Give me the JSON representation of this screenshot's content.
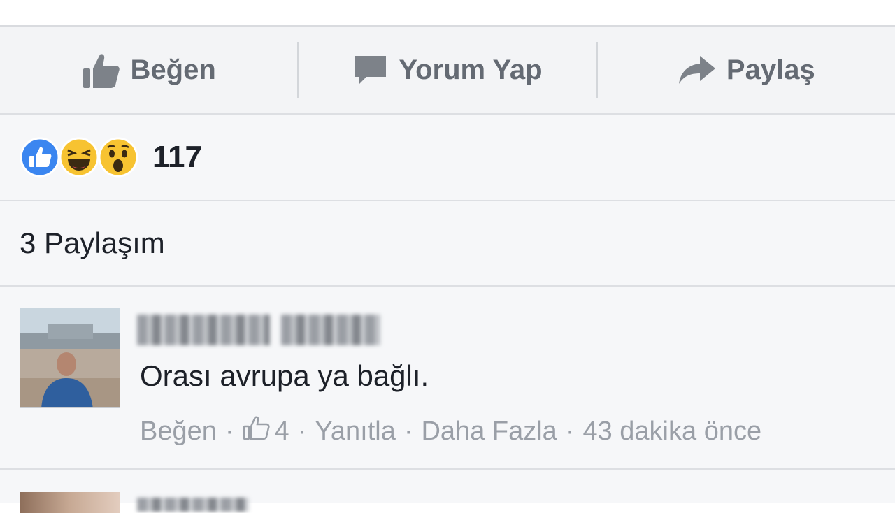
{
  "actions": {
    "like_label": "Beğen",
    "comment_label": "Yorum Yap",
    "share_label": "Paylaş"
  },
  "reactions": {
    "icons": [
      "like-reaction-icon",
      "haha-reaction-icon",
      "wow-reaction-icon"
    ],
    "count": "117"
  },
  "shares": {
    "label": "3 Paylaşım"
  },
  "comment": {
    "text": "Orası avrupa ya bağlı.",
    "like_label": "Beğen",
    "like_count": "4",
    "reply_label": "Yanıtla",
    "more_label": "Daha Fazla",
    "time": "43 dakika önce"
  },
  "colors": {
    "like_blue": "#3b86f0",
    "emoji_yellow": "#f7c331",
    "text_dark": "#1d2129",
    "text_gray": "#646a73",
    "meta_gray": "#9a9fa7"
  }
}
